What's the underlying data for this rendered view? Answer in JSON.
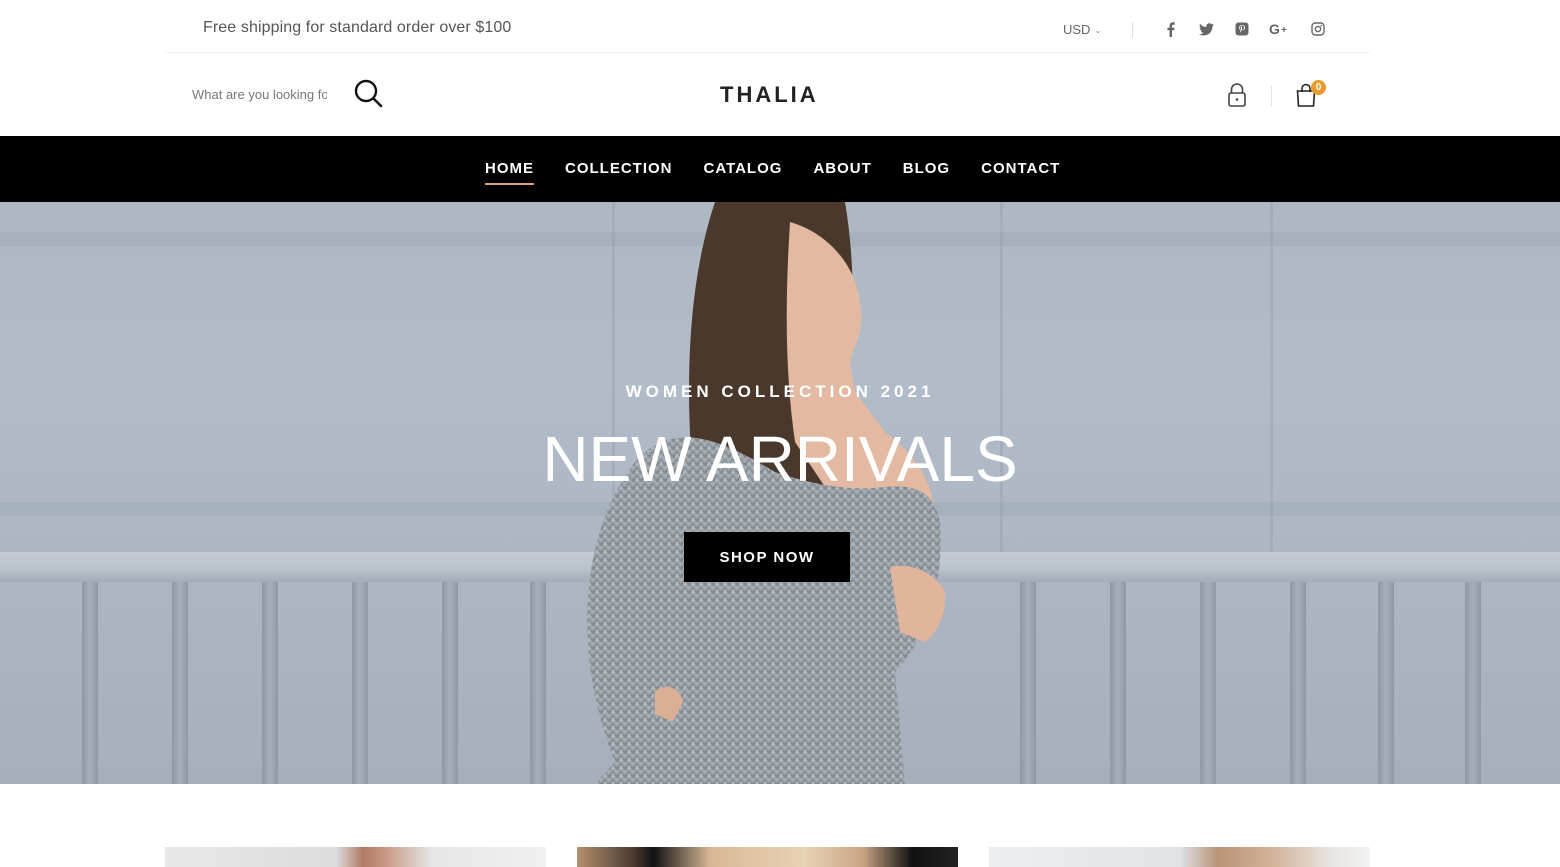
{
  "topbar": {
    "promo_text": "Free shipping for standard order over $100",
    "currency": "USD",
    "social": [
      {
        "name": "facebook-icon"
      },
      {
        "name": "twitter-icon"
      },
      {
        "name": "pinterest-icon"
      },
      {
        "name": "google-plus-icon"
      },
      {
        "name": "instagram-icon"
      }
    ]
  },
  "header": {
    "search_placeholder": "What are you looking for?",
    "logo": "THALIA",
    "cart_count": "0"
  },
  "nav": {
    "items": [
      {
        "label": "HOME",
        "active": true
      },
      {
        "label": "COLLECTION",
        "active": false
      },
      {
        "label": "CATALOG",
        "active": false
      },
      {
        "label": "ABOUT",
        "active": false
      },
      {
        "label": "BLOG",
        "active": false
      },
      {
        "label": "CONTACT",
        "active": false
      }
    ],
    "active_color": "#d9a273"
  },
  "hero": {
    "subtitle": "WOMEN COLLECTION 2021",
    "title": "NEW ARRIVALS",
    "cta_label": "SHOP NOW"
  },
  "colors": {
    "nav_bg": "#000000",
    "badge": "#e89a2c",
    "cta_bg": "#000000"
  }
}
